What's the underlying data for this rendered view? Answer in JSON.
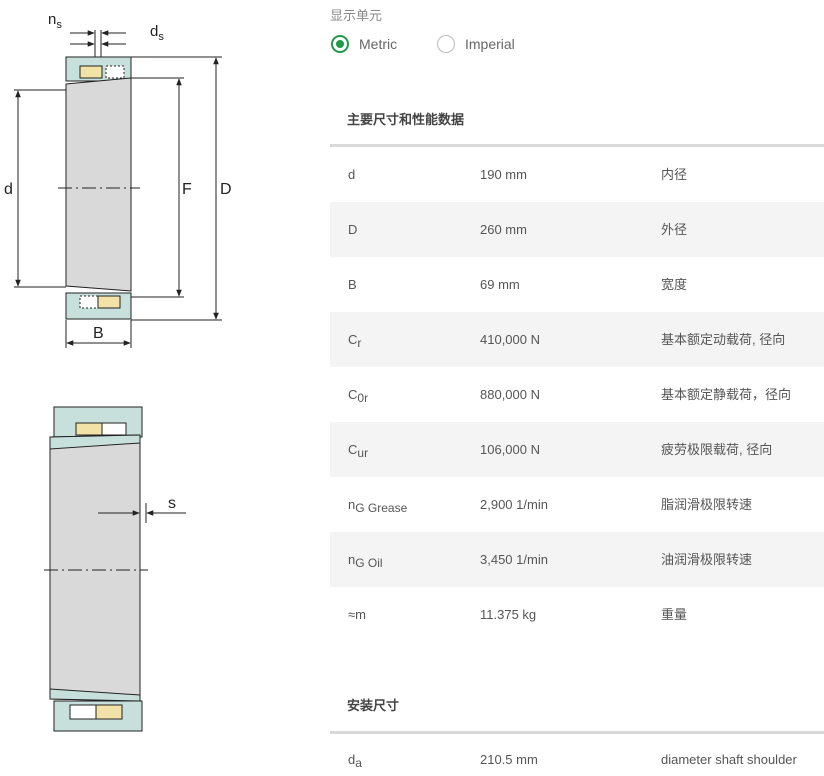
{
  "drawing": {
    "labels": {
      "ns": "n",
      "ns_sub": "s",
      "ds": "d",
      "ds_sub": "s",
      "d": "d",
      "F": "F",
      "D": "D",
      "B": "B",
      "s": "s"
    },
    "colors": {
      "ring": "#c7e0dc",
      "roller": "#f2e2a8",
      "inner": "#d9d9d9",
      "line": "#222222"
    }
  },
  "units": {
    "label": "显示单元",
    "options": [
      {
        "label": "Metric",
        "selected": true
      },
      {
        "label": "Imperial",
        "selected": false
      }
    ],
    "accent": "#1f9a4a"
  },
  "main": {
    "title": "主要尺寸和性能数据",
    "rows": [
      {
        "sym": "d",
        "sub": "",
        "value": "190 mm",
        "desc": "内径"
      },
      {
        "sym": "D",
        "sub": "",
        "value": "260 mm",
        "desc": "外径"
      },
      {
        "sym": "B",
        "sub": "",
        "value": "69 mm",
        "desc": "宽度"
      },
      {
        "sym": "C",
        "sub": "r",
        "value": "410,000 N",
        "desc": "基本额定动载荷, 径向"
      },
      {
        "sym": "C",
        "sub": "0r",
        "value": "880,000 N",
        "desc": "基本额定静载荷，径向"
      },
      {
        "sym": "C",
        "sub": "ur",
        "value": "106,000 N",
        "desc": "疲劳极限载荷, 径向"
      },
      {
        "sym": "n",
        "sub": "G Grease",
        "value": "2,900 1/min",
        "desc": "脂润滑极限转速"
      },
      {
        "sym": "n",
        "sub": "G Oil",
        "value": "3,450 1/min",
        "desc": "油润滑极限转速"
      },
      {
        "sym": "≈m",
        "sub": "",
        "value": "11.375 kg",
        "desc": "重量"
      }
    ]
  },
  "mounting": {
    "title": "安装尺寸",
    "rows": [
      {
        "sym": "d",
        "sub": "a",
        "value": "210.5 mm",
        "desc": "diameter shaft shoulder"
      }
    ]
  }
}
